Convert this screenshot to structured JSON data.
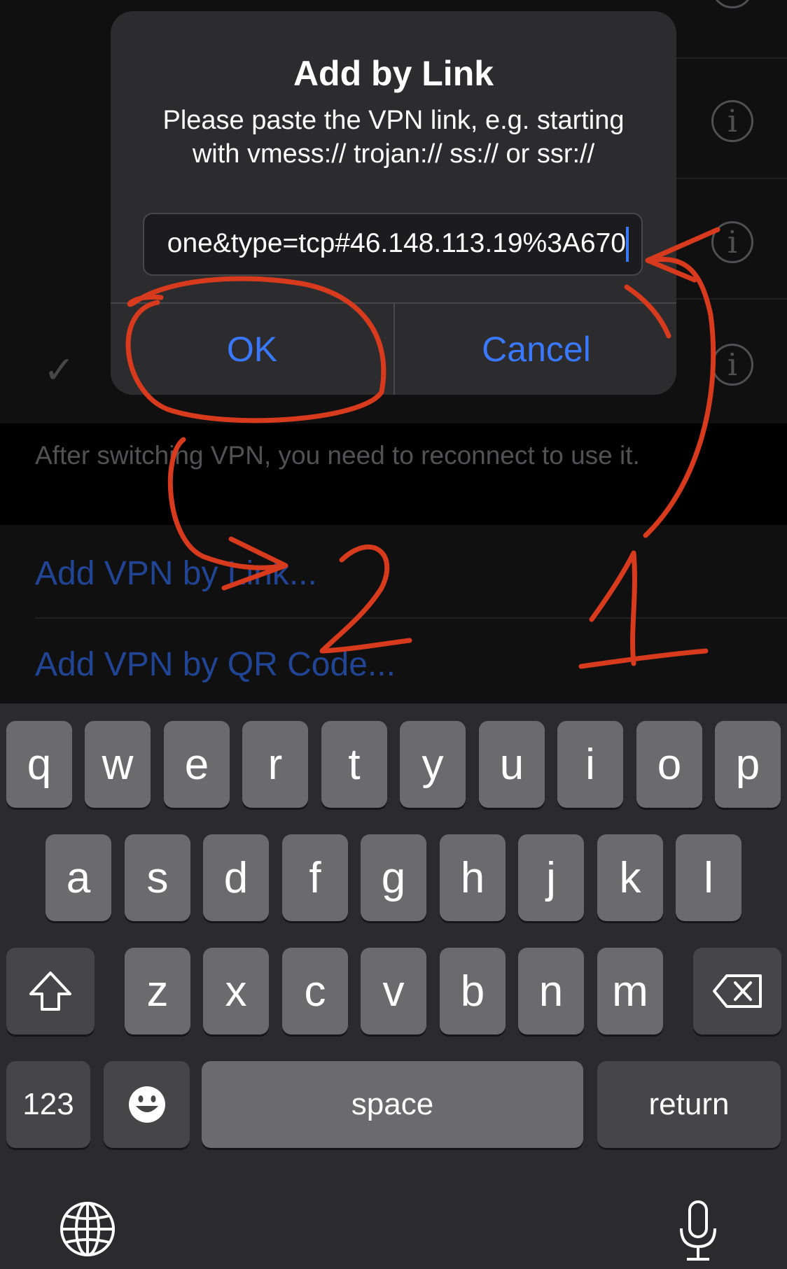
{
  "background": {
    "rows": [
      {
        "text": "",
        "has_check": false
      },
      {
        "text": "",
        "has_check": false
      },
      {
        "text": "",
        "has_check": false
      },
      {
        "text": "",
        "has_check": true
      }
    ],
    "footer_note": "After switching VPN, you need to reconnect to use it.",
    "actions": [
      "Add VPN by Link...",
      "Add VPN by QR Code..."
    ]
  },
  "alert": {
    "title": "Add by Link",
    "message": "Please paste the VPN link, e.g. starting with vmess:// trojan:// ss:// or ssr://",
    "input_value": "one&type=tcp#46.148.113.19%3A670",
    "ok_label": "OK",
    "cancel_label": "Cancel"
  },
  "annotations": {
    "label_1": "1",
    "label_2": "2",
    "color": "#d83a1e"
  },
  "keyboard": {
    "row1": [
      "q",
      "w",
      "e",
      "r",
      "t",
      "y",
      "u",
      "i",
      "o",
      "p"
    ],
    "row2": [
      "a",
      "s",
      "d",
      "f",
      "g",
      "h",
      "j",
      "k",
      "l"
    ],
    "row3": [
      "z",
      "x",
      "c",
      "v",
      "b",
      "n",
      "m"
    ],
    "numbers_label": "123",
    "space_label": "space",
    "return_label": "return"
  },
  "colors": {
    "accent": "#3a78ff",
    "alert_bg": "#2c2c2e",
    "key_bg": "#6b6b6e",
    "key_dark_bg": "#464649",
    "keyboard_bg": "#2b2b2d"
  }
}
